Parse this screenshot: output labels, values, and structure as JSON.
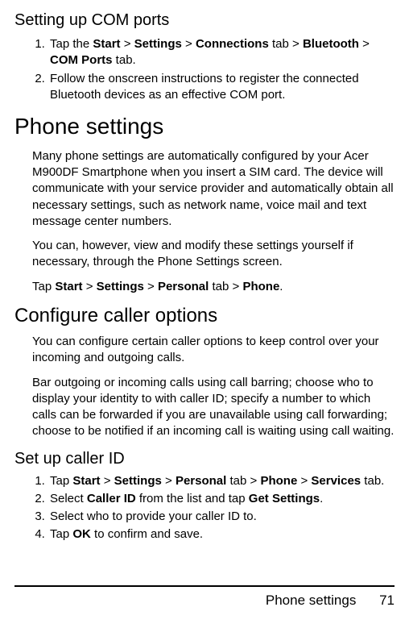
{
  "section1": {
    "title": "Setting up COM ports",
    "step1_parts": [
      "Tap the ",
      "Start",
      " > ",
      "Settings",
      " > ",
      "Connections",
      " tab > ",
      "Bluetooth",
      " > ",
      "COM Ports",
      " tab."
    ],
    "step2": "Follow the onscreen instructions to register the connected Bluetooth devices as an effective COM port."
  },
  "phone_settings": {
    "heading": "Phone settings",
    "para1": "Many phone settings are automatically configured by your Acer M900DF Smartphone when you insert a SIM card. The device will communicate with your service provider and automatically obtain all necessary settings, such as network name, voice mail and text message center numbers.",
    "para2": "You can, however, view and modify these settings yourself if necessary, through the Phone Settings screen.",
    "tap_line_parts": [
      "Tap ",
      "Start",
      " > ",
      "Settings",
      " > ",
      "Personal",
      " tab > ",
      "Phone",
      "."
    ]
  },
  "configure_caller": {
    "heading": "Configure caller options",
    "para1": "You can configure certain caller options to keep control over your incoming and outgoing calls.",
    "para2": "Bar outgoing or incoming calls using call barring; choose who to display your identity to with caller ID; specify a number to which calls can be forwarded if you are unavailable using call forwarding; choose to be notified if an incoming call is waiting using call waiting."
  },
  "caller_id": {
    "heading": "Set up caller ID",
    "step1_parts": [
      "Tap ",
      "Start",
      " > ",
      "Settings",
      " > ",
      "Personal",
      " tab > ",
      "Phone",
      " > ",
      "Services",
      " tab."
    ],
    "step2_parts": [
      "Select ",
      "Caller ID",
      " from the list and tap ",
      "Get Settings",
      "."
    ],
    "step3": "Select who to provide your caller ID to.",
    "step4_parts": [
      "Tap ",
      "OK",
      " to confirm and save."
    ]
  },
  "footer": {
    "label": "Phone settings",
    "page": "71"
  }
}
